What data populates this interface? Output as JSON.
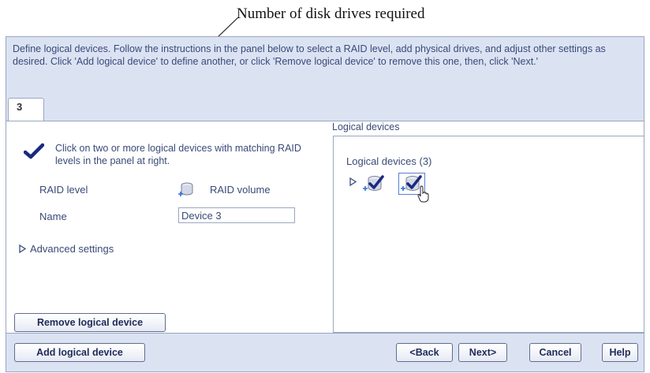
{
  "callout": {
    "text": "Number of disk drives required"
  },
  "instructions": {
    "text": "Define logical devices. Follow the instructions in the panel below to select a RAID level, add physical drives, and adjust other settings as desired. Click 'Add logical device' to define another, or click 'Remove logical device' to remove this one, then, click 'Next.'"
  },
  "tab": {
    "label": "3"
  },
  "left_panel": {
    "instruction": "Click on two or more logical devices with matching RAID levels in the panel at right.",
    "raid_level_label": "RAID level",
    "raid_level_value": "RAID volume",
    "name_label": "Name",
    "name_value": "Device 3",
    "advanced_label": "Advanced settings",
    "remove_button": "Remove logical device"
  },
  "right_panel": {
    "title": "Logical devices",
    "tree_label": "Logical devices (3)"
  },
  "footer": {
    "add_button": "Add logical device",
    "back_button": "<Back",
    "next_button": "Next>",
    "cancel_button": "Cancel",
    "help_button": "Help"
  },
  "icons": {
    "check": "checkmark-icon",
    "raid": "raid-volume-icon",
    "expand": "expand-triangle-icon",
    "device": "logical-device-icon",
    "cursor": "hand-cursor-icon"
  },
  "colors": {
    "panel_background": "#dbe3f3",
    "border": "#9aa6bf",
    "text": "#3a4a78",
    "check": "#1a2a80"
  }
}
